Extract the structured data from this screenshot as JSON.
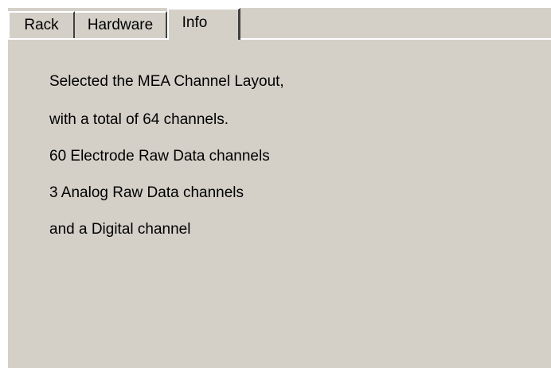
{
  "tabs": [
    {
      "label": "Rack"
    },
    {
      "label": "Hardware"
    },
    {
      "label": "Info"
    }
  ],
  "active_tab": "Info",
  "info": {
    "lines": [
      "Selected the MEA Channel Layout,",
      "with a total of 64 channels.",
      "60 Electrode Raw Data channels",
      "3 Analog Raw Data channels",
      "and a Digital channel"
    ]
  }
}
